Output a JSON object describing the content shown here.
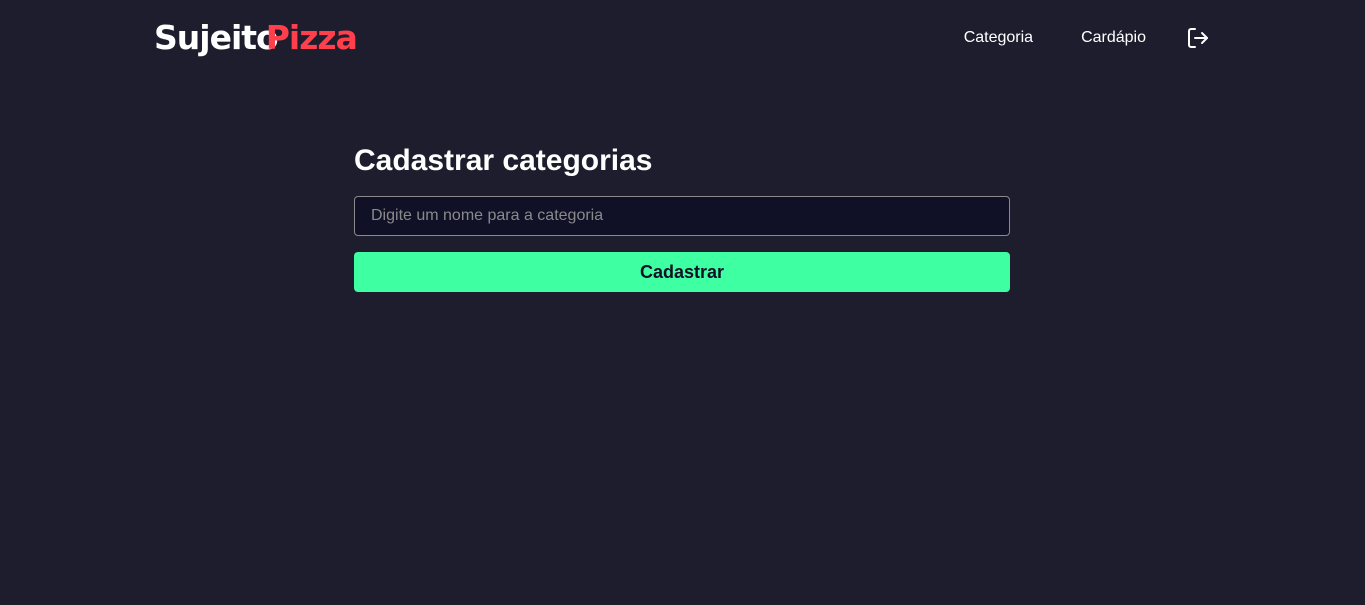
{
  "header": {
    "logo": {
      "first": "Sujeito",
      "second": "Pizza"
    },
    "nav": {
      "category_label": "Categoria",
      "menu_label": "Cardápio",
      "logout_icon": "log-out-icon"
    }
  },
  "main": {
    "title": "Cadastrar categorias",
    "input": {
      "value": "",
      "placeholder": "Digite um nome para a categoria"
    },
    "submit_label": "Cadastrar"
  },
  "colors": {
    "background": "#1d1d2e",
    "input_background": "#101026",
    "accent_red": "#ff3f4b",
    "accent_green": "#3fffa3",
    "text": "#ffffff",
    "border": "#8a8a8a"
  }
}
